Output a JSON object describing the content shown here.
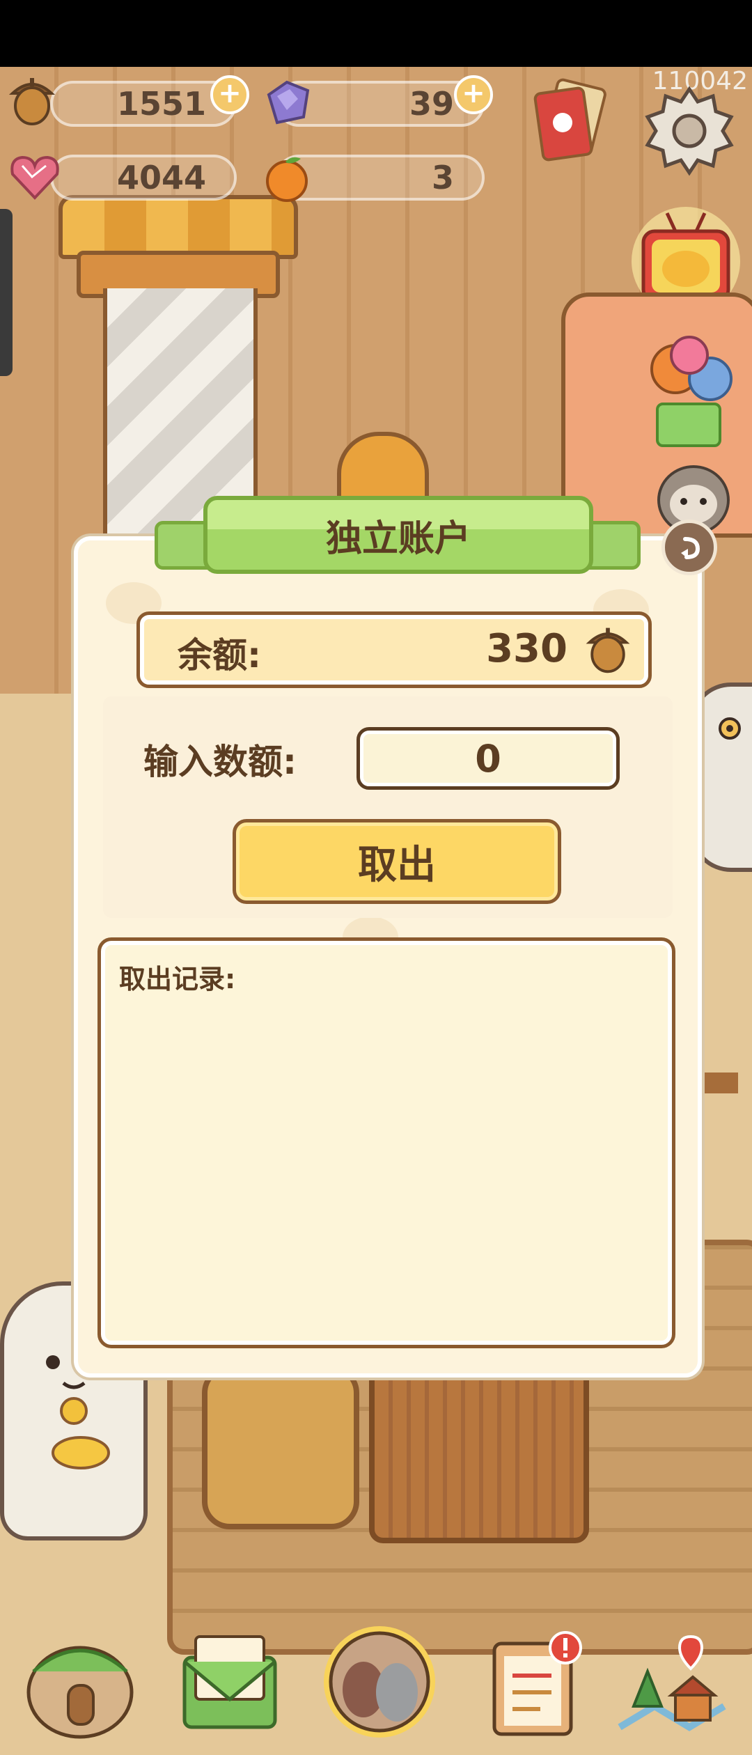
{
  "hud": {
    "acorns": "1551",
    "gems": "39",
    "hearts": "4044",
    "oranges": "3",
    "plus": "+",
    "player_id": "110042"
  },
  "icons": {
    "acorn": "acorn-icon",
    "gem": "purple-gem-icon",
    "heart": "heart-crystal-icon",
    "orange": "orange-icon",
    "settings": "gear-icon",
    "cards": "card-deck-icon",
    "tv": "tv-icon",
    "balloons": "balloon-gift-icon",
    "sloth": "sloth-icon"
  },
  "dialog": {
    "title": "独立账户",
    "balance_label": "余额:",
    "balance_value": "330",
    "input_label": "输入数额:",
    "input_value": "0",
    "withdraw_button": "取出",
    "records_label": "取出记录:"
  },
  "bottom_nav": [
    "house-icon",
    "letter-icon",
    "cats-icon",
    "tasks-icon",
    "map-icon"
  ],
  "colors": {
    "panel_bg": "#fdf3dc",
    "ribbon_green": "#a4d766",
    "button_yellow": "#fdd765",
    "text_brown": "#5b3d22"
  }
}
